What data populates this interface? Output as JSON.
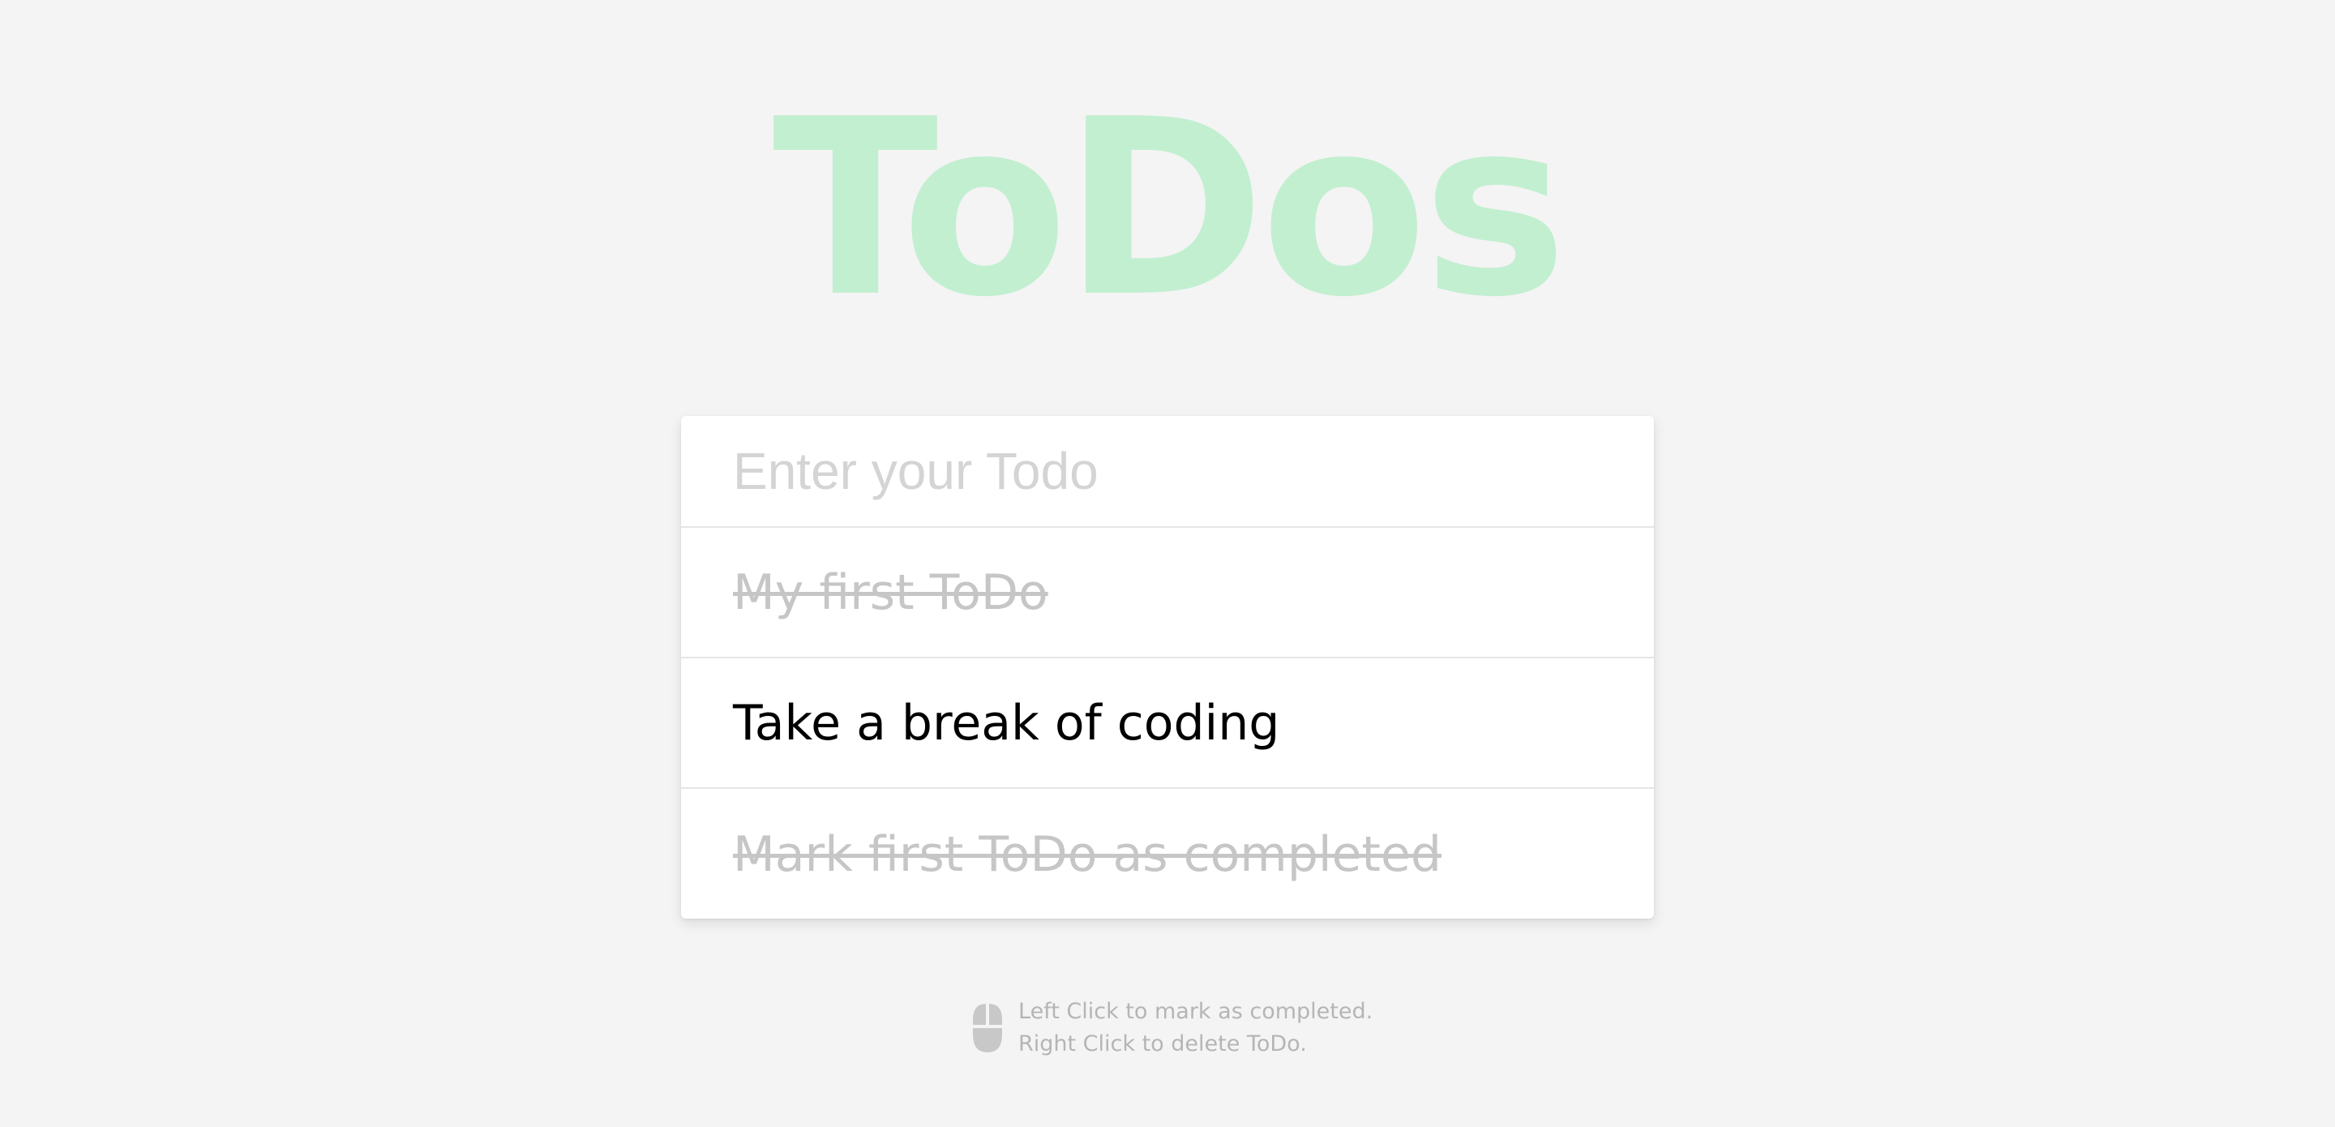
{
  "app": {
    "title": "ToDos",
    "title_color": "#c2efd0"
  },
  "input": {
    "value": "",
    "placeholder": "Enter your Todo"
  },
  "todos": [
    {
      "label": "My first ToDo",
      "completed": true
    },
    {
      "label": "Take a break of coding",
      "completed": false
    },
    {
      "label": "Mark first ToDo as completed",
      "completed": true
    }
  ],
  "hint": {
    "icon": "mouse-icon",
    "left_click": "Left Click to mark as completed.",
    "right_click": "Right Click to delete ToDo."
  },
  "colors": {
    "background": "#f4f4f4",
    "card": "#ffffff",
    "completed_text": "#c6c6c6",
    "active_text": "#000000",
    "hint_text": "#b5b5b5"
  }
}
